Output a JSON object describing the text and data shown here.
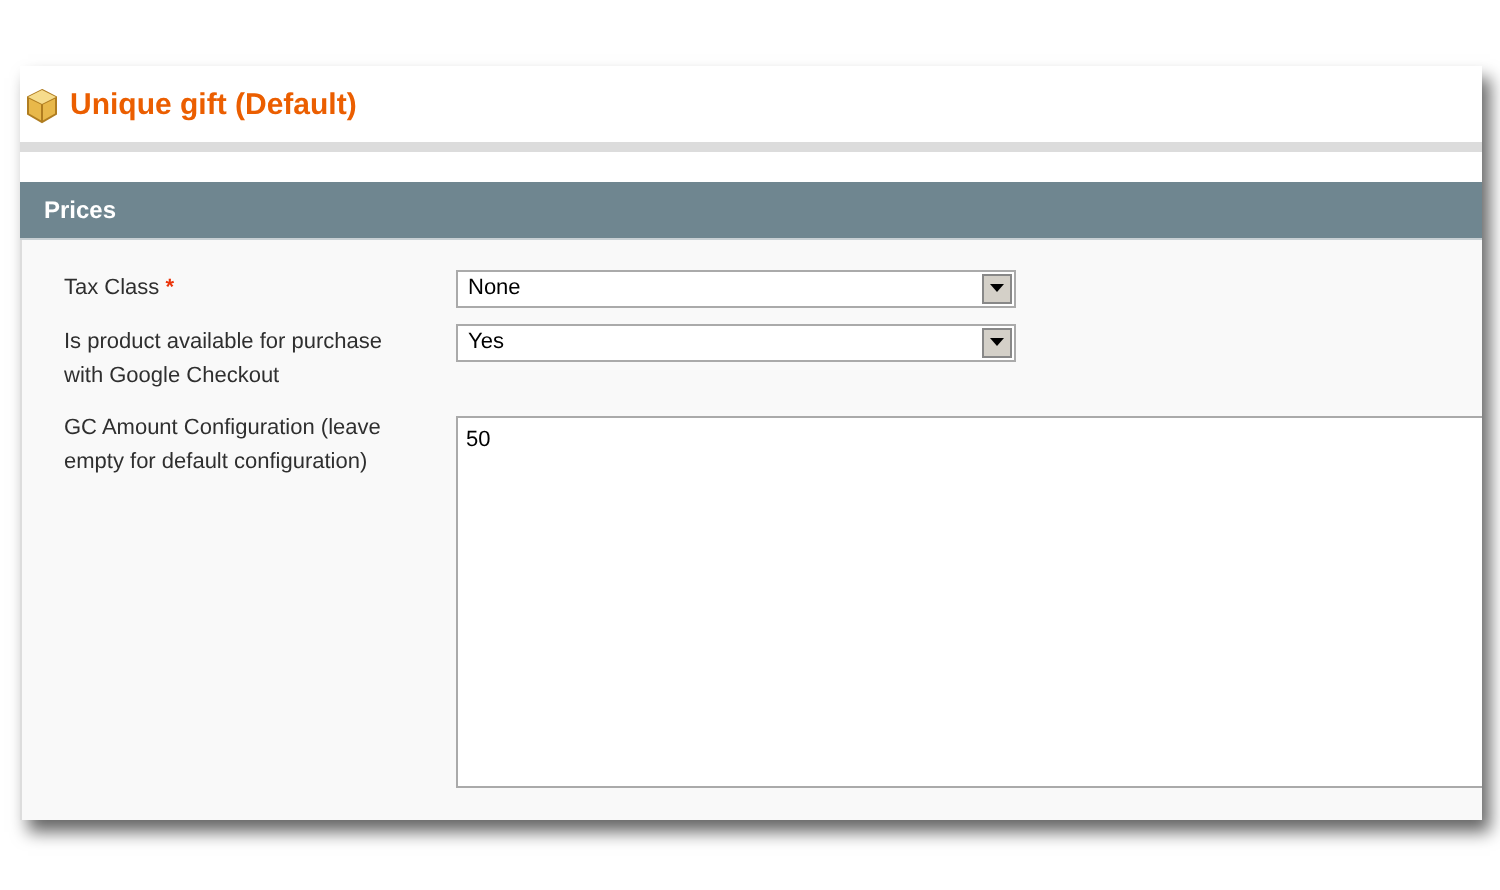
{
  "page_title": "Unique gift (Default)",
  "section": {
    "title": "Prices"
  },
  "fields": [
    {
      "kind": "select",
      "label": "Tax Class",
      "required_mark": "*",
      "value": "None"
    },
    {
      "kind": "select",
      "label": "Is product available for purchase with Google Checkout",
      "value": "Yes"
    },
    {
      "kind": "textarea",
      "label": "GC Amount Configuration (leave empty for default configuration)",
      "value": "50"
    }
  ]
}
